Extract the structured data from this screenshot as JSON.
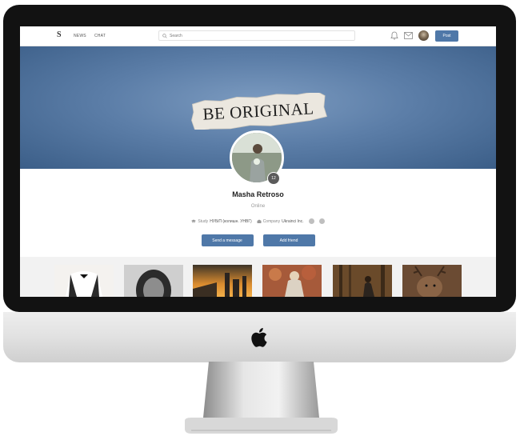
{
  "topbar": {
    "logo": "S",
    "nav": [
      "NEWS",
      "CHAT"
    ],
    "search_placeholder": "Search",
    "post_label": "Post"
  },
  "cover": {
    "headline": "BE ORIGINAL"
  },
  "profile": {
    "photo_badge": "12",
    "name": "Masha Retroso",
    "status": "Online",
    "study_label": "Study",
    "study_value": "НУБіП (колишн. УНВГ)",
    "company_label": "Company",
    "company_value": "Ukrainci Inc."
  },
  "actions": {
    "send_message": "Send a message",
    "add_friend": "Add friend"
  },
  "gallery": {
    "thumbnails": [
      "man-suit",
      "woman-portrait",
      "city-sunset",
      "woman-flowers",
      "woman-forest",
      "deer"
    ]
  },
  "colors": {
    "accent": "#4f78a8",
    "cover": "#5c7ea8",
    "frame": "#121212"
  }
}
